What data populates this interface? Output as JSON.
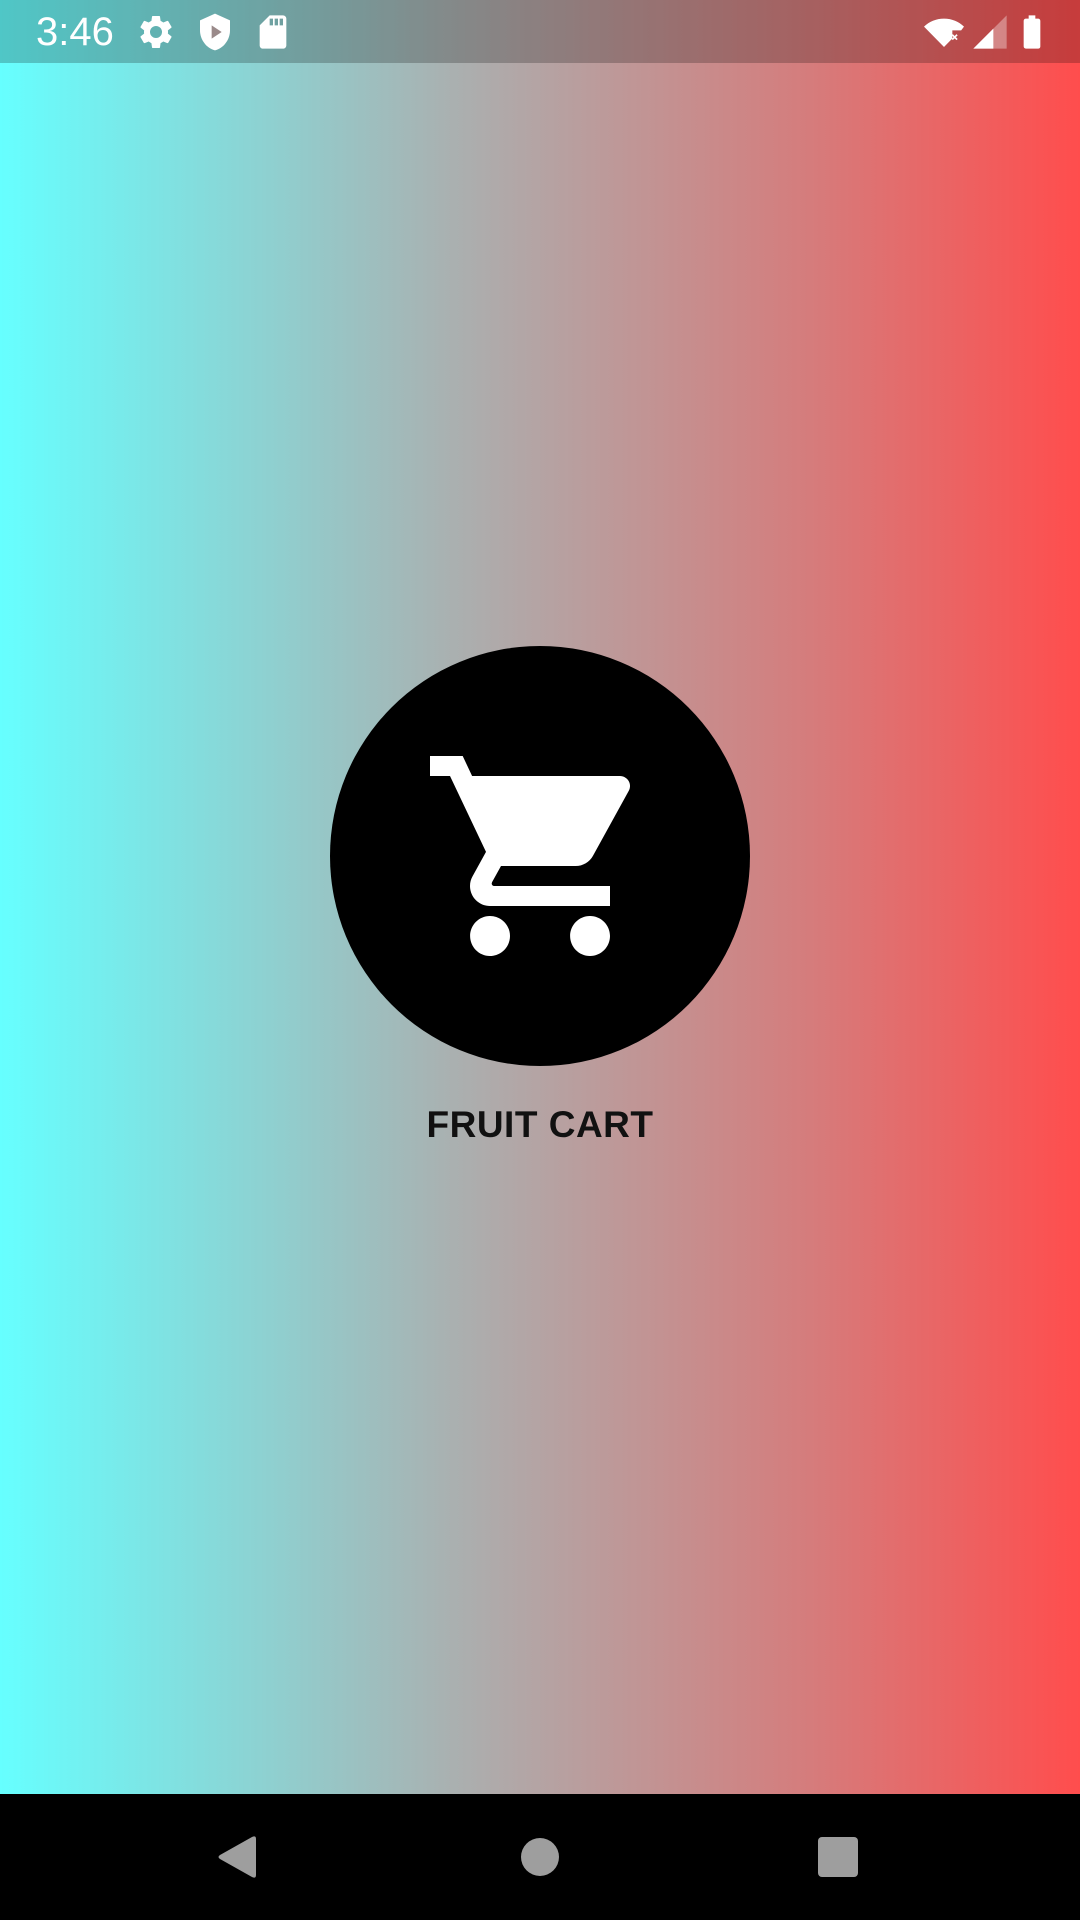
{
  "status_bar": {
    "time": "3:46",
    "icons": [
      "gear-icon",
      "shield-play-icon",
      "sd-card-icon",
      "wifi-off-icon",
      "signal-icon",
      "battery-icon"
    ]
  },
  "app": {
    "title": "FRUIT CART",
    "logo_icon": "shopping-cart-icon"
  },
  "navigation": {
    "buttons": [
      "back-icon",
      "home-icon",
      "recents-icon"
    ]
  },
  "colors": {
    "gradient_left": "#66FFFF",
    "gradient_right": "#FF4D4D",
    "logo_background": "#000000",
    "logo_icon": "#FFFFFF",
    "nav_bar": "#000000",
    "nav_buttons": "#9E9E9E"
  }
}
